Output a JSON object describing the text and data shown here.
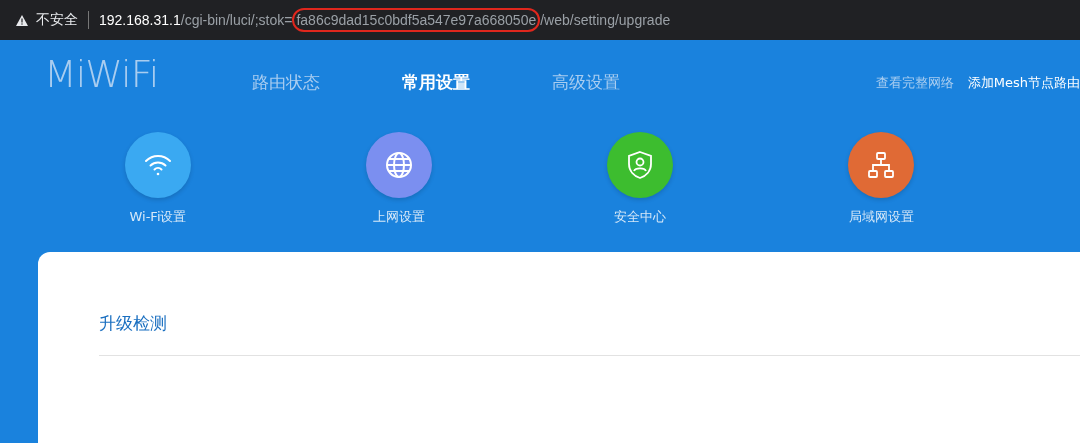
{
  "address_bar": {
    "security": "不安全",
    "url_parts": [
      {
        "kind": "host",
        "text": "192.168.31.1"
      },
      {
        "kind": "path",
        "text": "/cgi-bin/luci/;stok="
      },
      {
        "kind": "highlight",
        "text": "fa86c9dad15c0bdf5a547e97a668050e"
      },
      {
        "kind": "path",
        "text": "/web/setting/upgrade"
      }
    ]
  },
  "header": {
    "logo": "MiWiFi",
    "tabs": [
      {
        "label": "路由状态",
        "selected": false
      },
      {
        "label": "常用设置",
        "selected": true
      },
      {
        "label": "高级设置",
        "selected": false
      }
    ],
    "links": [
      {
        "label": "查看完整网络",
        "kind": "muted"
      },
      {
        "label": "添加Mesh节点路由",
        "kind": "bright"
      }
    ]
  },
  "shortcuts": [
    {
      "label": "Wi-Fi设置",
      "kind": "wifi",
      "color": "#3aa9f2"
    },
    {
      "label": "上网设置",
      "kind": "globe",
      "color": "#7b8ff0"
    },
    {
      "label": "安全中心",
      "kind": "shield",
      "color": "#3dbd2f"
    },
    {
      "label": "局域网设置",
      "kind": "network",
      "color": "#e06a35"
    }
  ],
  "panel": {
    "title": "升级检测"
  }
}
